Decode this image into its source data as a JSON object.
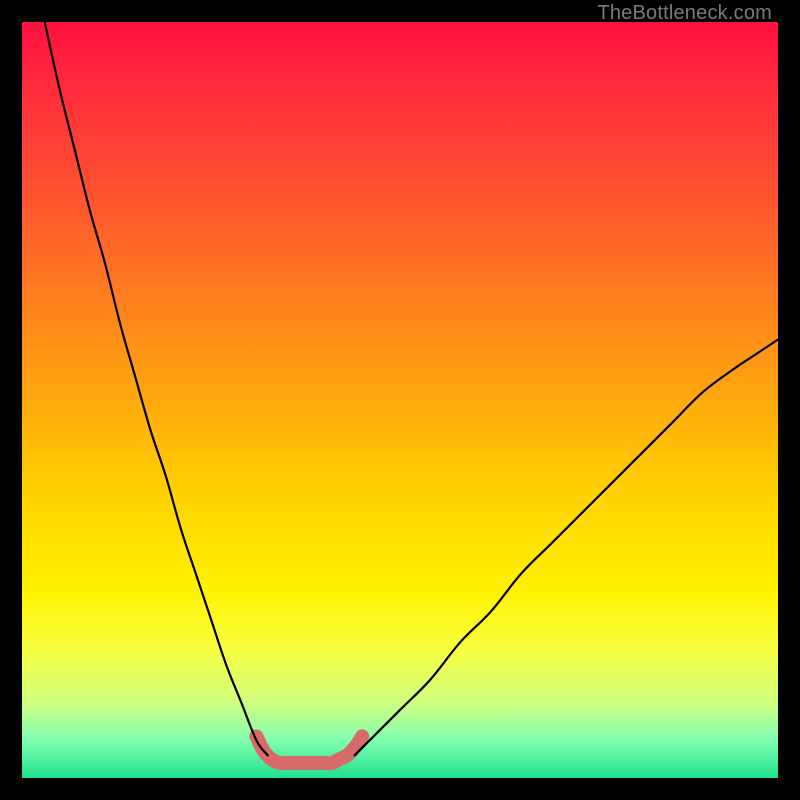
{
  "watermark": "TheBottleneck.com",
  "chart_data": {
    "type": "line",
    "title": "",
    "xlabel": "",
    "ylabel": "",
    "xlim": [
      0,
      100
    ],
    "ylim": [
      0,
      100
    ],
    "series": [
      {
        "name": "left-curve",
        "x": [
          3,
          5,
          7,
          9,
          11,
          13,
          15,
          17,
          19,
          21,
          23,
          25,
          27,
          29,
          31,
          32.5
        ],
        "y": [
          100,
          91,
          83,
          75,
          68,
          60,
          53,
          46,
          40,
          33,
          27,
          21,
          15,
          10,
          5,
          3
        ],
        "color": "#000000",
        "width": 2.2
      },
      {
        "name": "right-curve",
        "x": [
          44,
          46,
          50,
          54,
          58,
          62,
          66,
          70,
          74,
          78,
          82,
          86,
          90,
          94,
          97,
          100
        ],
        "y": [
          3,
          5,
          9,
          13,
          18,
          22,
          27,
          31,
          35,
          39,
          43,
          47,
          51,
          54,
          56,
          58
        ],
        "color": "#000000",
        "width": 2.2
      },
      {
        "name": "pink-trough",
        "x": [
          31,
          32,
          33,
          34,
          35,
          36,
          37,
          38,
          39,
          40,
          41,
          42,
          43,
          44,
          45
        ],
        "y": [
          5.5,
          3.5,
          2.5,
          2,
          2,
          2,
          2,
          2,
          2,
          2,
          2,
          2.5,
          3,
          4,
          5.5
        ],
        "color": "#d96a6a",
        "width": 14
      }
    ]
  }
}
